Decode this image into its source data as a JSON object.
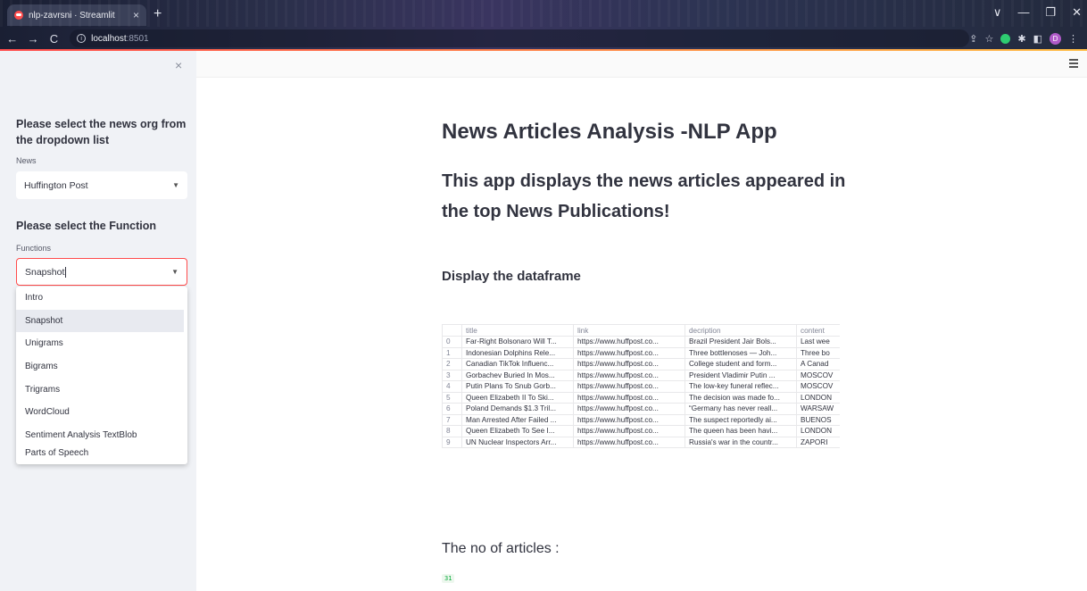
{
  "browser": {
    "tab_title": "nlp-zavrsni · Streamlit",
    "tab_close": "×",
    "new_tab": "+",
    "back": "←",
    "forward": "→",
    "reload": "C",
    "url_host": "localhost",
    "url_port": ":8501",
    "profile_letter": "D",
    "window_controls": [
      "∨",
      "—",
      "❐",
      "✕"
    ]
  },
  "sidebar": {
    "close_icon": "×",
    "news_heading": "Please select the news org from the dropdown list",
    "news_label": "News",
    "news_selected": "Huffington Post",
    "function_heading": "Please select the Function",
    "function_label": "Functions",
    "function_value": "Snapshot",
    "function_options": [
      "Intro",
      "Snapshot",
      "Unigrams",
      "Bigrams",
      "Trigrams",
      "WordCloud",
      "Sentiment Analysis TextBlob",
      "Parts of Speech"
    ],
    "highlighted_option": "Snapshot"
  },
  "main": {
    "title": "News Articles Analysis -NLP App",
    "subtitle": "This app displays the news articles appeared in the top News Publications!",
    "section_heading": "Display the dataframe",
    "table": {
      "columns": [
        "",
        "title",
        "link",
        "decription",
        "content"
      ],
      "rows": [
        [
          "0",
          "Far-Right Bolsonaro Will T...",
          "https://www.huffpost.co...",
          "Brazil President Jair Bols...",
          "Last wee"
        ],
        [
          "1",
          "Indonesian Dolphins Rele...",
          "https://www.huffpost.co...",
          "Three bottlenoses — Joh...",
          "Three bo"
        ],
        [
          "2",
          "Canadian TikTok Influenc...",
          "https://www.huffpost.co...",
          "College student and form...",
          "A Canad"
        ],
        [
          "3",
          "Gorbachev Buried In Mos...",
          "https://www.huffpost.co...",
          "President Vladimir Putin ...",
          "MOSCOV"
        ],
        [
          "4",
          "Putin Plans To Snub Gorb...",
          "https://www.huffpost.co...",
          "The low-key funeral reflec...",
          "MOSCOV"
        ],
        [
          "5",
          "Queen Elizabeth II To Ski...",
          "https://www.huffpost.co...",
          "The decision was made fo...",
          "LONDON"
        ],
        [
          "6",
          "Poland Demands $1.3 Tril...",
          "https://www.huffpost.co...",
          "“Germany has never reall...",
          "WARSAW"
        ],
        [
          "7",
          "Man Arrested After Failed ...",
          "https://www.huffpost.co...",
          "The suspect reportedly ai...",
          "BUENOS"
        ],
        [
          "8",
          "Queen Elizabeth To See I...",
          "https://www.huffpost.co...",
          "The queen has been havi...",
          "LONDON"
        ],
        [
          "9",
          "UN Nuclear Inspectors Arr...",
          "https://www.huffpost.co...",
          "Russia's war in the countr...",
          "ZAPORI"
        ]
      ]
    },
    "count_label": "The no of articles :",
    "count_value": "31"
  }
}
